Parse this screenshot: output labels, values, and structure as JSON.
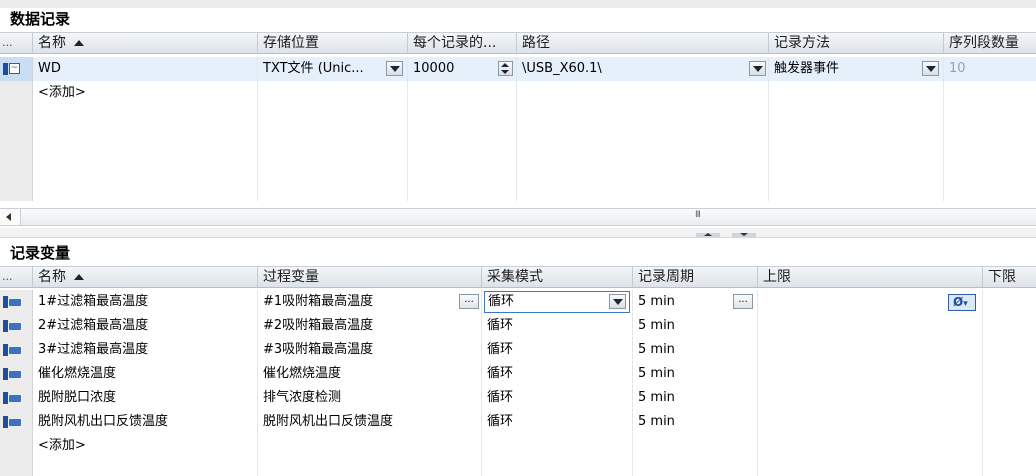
{
  "data_log": {
    "title": "数据记录",
    "columns": [
      "...",
      "名称",
      "存储位置",
      "每个记录的...",
      "路径",
      "记录方法",
      "序列段数量"
    ],
    "rows": [
      {
        "name": "WD",
        "storage": "TXT文件 (Unic...",
        "records": "10000",
        "path": "\\USB_X60.1\\",
        "method": "触发器事件",
        "segments": "10"
      }
    ],
    "add_label": "<添加>",
    "scrollbar_grip": "III"
  },
  "log_tags": {
    "title": "记录变量",
    "columns": [
      "...",
      "名称",
      "过程变量",
      "采集模式",
      "记录周期",
      "上限",
      "下限"
    ],
    "rows": [
      {
        "name": "1#过滤箱最高温度",
        "process_tag": "#1吸附箱最高温度",
        "mode": "循环",
        "cycle": "5 min"
      },
      {
        "name": "2#过滤箱最高温度",
        "process_tag": "#2吸附箱最高温度",
        "mode": "循环",
        "cycle": "5 min"
      },
      {
        "name": "3#过滤箱最高温度",
        "process_tag": "#3吸附箱最高温度",
        "mode": "循环",
        "cycle": "5 min"
      },
      {
        "name": "催化燃烧温度",
        "process_tag": "催化燃烧温度",
        "mode": "循环",
        "cycle": "5 min"
      },
      {
        "name": "脱附脱口浓度",
        "process_tag": "排气浓度检测",
        "mode": "循环",
        "cycle": "5 min"
      },
      {
        "name": "脱附风机出口反馈温度",
        "process_tag": "脱附风机出口反馈温度",
        "mode": "循环",
        "cycle": "5 min"
      }
    ],
    "add_label": "<添加>",
    "upper_limit_button": "Ø"
  }
}
